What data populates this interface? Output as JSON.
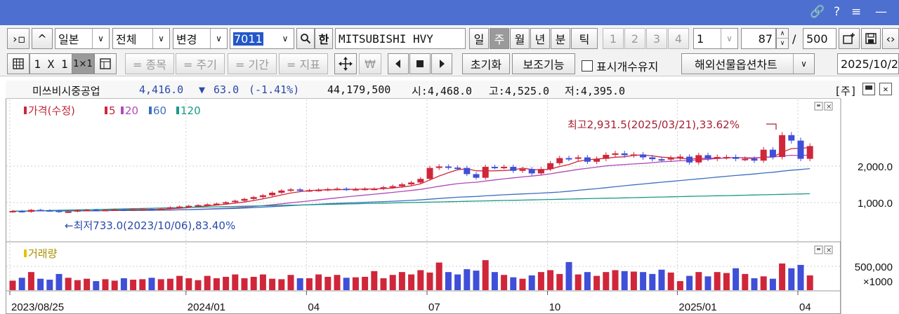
{
  "window": {
    "icons": [
      "link-icon",
      "help-icon",
      "menu-icon",
      "minimize-icon"
    ],
    "glyphs": [
      "🔗",
      "?",
      "≡",
      "—"
    ]
  },
  "toolbar1": {
    "arrow_btn": "›◻",
    "up_btn": "^",
    "market": "일본",
    "scope": "전체",
    "change": "변경",
    "code": "7011",
    "han": "한",
    "stock_name": "MITSUBISHI HVY",
    "periods": [
      "일",
      "주",
      "월",
      "년",
      "분",
      "틱"
    ],
    "active_period": "주",
    "layouts": [
      "1",
      "2",
      "3",
      "4"
    ],
    "multiplier": "1",
    "count": "87",
    "slash": "/",
    "max_count": "500"
  },
  "toolbar2": {
    "grid_label": "1 X 1",
    "grid_active": "1×1",
    "filters": [
      "= 종목",
      "= 주기",
      "= 기간",
      "= 지표"
    ],
    "currency": "₩",
    "reset": "초기화",
    "aux": "보조기능",
    "keep_label": "표시개수유지",
    "overseas": "해외선물옵션차트",
    "date": "2025/10/2"
  },
  "info": {
    "name": "미쓰비시중공업",
    "price": "4,416.0",
    "arrow": "▼",
    "change": "63.0",
    "pct": "(-1.41%)",
    "volume": "44,179,500",
    "open": "시:4,468.0",
    "high": "고:4,525.0",
    "low": "저:4,395.0",
    "unit": "[주]"
  },
  "chart_data": {
    "type": "candlestick",
    "interval": "weekly",
    "price_legend": [
      {
        "name": "가격(수정)",
        "color": "#d0263a"
      },
      {
        "name": "5",
        "color": "#d0263a"
      },
      {
        "name": "20",
        "color": "#b04ab8"
      },
      {
        "name": "60",
        "color": "#3d6fc0"
      },
      {
        "name": "120",
        "color": "#1a9a86"
      }
    ],
    "y_ticks": [
      "2,000.0",
      "1,000.0"
    ],
    "y_tick_values": [
      2000,
      1000
    ],
    "high_annotation": "최고2,931.5(2025/03/21),33.62%",
    "low_annotation": "←최저733.0(2023/10/06),83.40%",
    "volume_legend": "거래량",
    "volume_tick": "500,000",
    "volume_unit": "×1000",
    "volume_tick_value": 500000,
    "x_ticks": [
      "2023/08/25",
      "2024/01",
      "04",
      "07",
      "10",
      "2025/01",
      "04"
    ],
    "x_tick_index": [
      0,
      19,
      32,
      45,
      58,
      72,
      85
    ],
    "up_color": "#d0263a",
    "down_color": "#3f4fd8",
    "closes": [
      770,
      745,
      800,
      790,
      780,
      740,
      755,
      790,
      800,
      790,
      800,
      810,
      800,
      815,
      820,
      810,
      830,
      870,
      890,
      910,
      930,
      950,
      970,
      1010,
      1050,
      1100,
      1150,
      1200,
      1270,
      1330,
      1360,
      1330,
      1340,
      1350,
      1370,
      1380,
      1360,
      1370,
      1380,
      1380,
      1420,
      1450,
      1500,
      1550,
      1650,
      1950,
      1990,
      1960,
      1950,
      1780,
      1680,
      1980,
      1970,
      1980,
      1870,
      1920,
      1800,
      1920,
      2080,
      2220,
      2200,
      2240,
      2120,
      2200,
      2310,
      2350,
      2300,
      2320,
      2240,
      2190,
      2180,
      2220,
      2260,
      2100,
      2300,
      2200,
      2250,
      2250,
      2200,
      2200,
      2150,
      2450,
      2250,
      2850,
      2700,
      2200,
      2550
    ],
    "volumes": [
      200000,
      260000,
      380000,
      240000,
      220000,
      340000,
      260000,
      210000,
      240000,
      190000,
      230000,
      200000,
      250000,
      220000,
      230000,
      260000,
      230000,
      240000,
      300000,
      250000,
      210000,
      300000,
      250000,
      280000,
      330000,
      250000,
      280000,
      330000,
      240000,
      230000,
      320000,
      250000,
      250000,
      330000,
      280000,
      320000,
      260000,
      270000,
      280000,
      400000,
      250000,
      320000,
      380000,
      330000,
      420000,
      370000,
      580000,
      380000,
      330000,
      440000,
      410000,
      630000,
      380000,
      320000,
      270000,
      240000,
      310000,
      380000,
      420000,
      340000,
      590000,
      330000,
      380000,
      300000,
      380000,
      420000,
      400000,
      390000,
      380000,
      340000,
      430000,
      370000,
      190000,
      300000,
      380000,
      290000,
      380000,
      360000,
      460000,
      340000,
      250000,
      290000,
      240000,
      560000,
      460000,
      530000,
      310000
    ]
  }
}
